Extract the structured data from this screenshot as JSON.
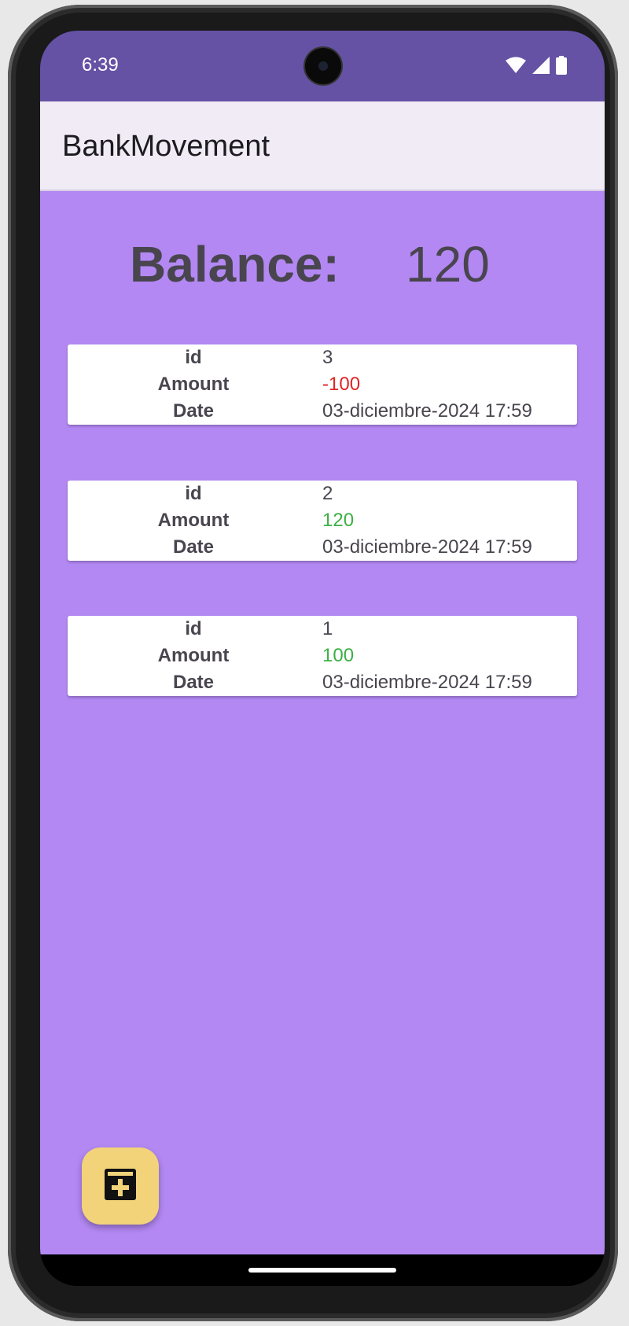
{
  "status_bar": {
    "time": "6:39",
    "icons": [
      "wifi-icon",
      "signal-icon",
      "battery-icon"
    ]
  },
  "app_bar": {
    "title": "BankMovement"
  },
  "balance": {
    "label": "Balance:",
    "value": "120"
  },
  "movements": [
    {
      "id_label": "id",
      "id": "3",
      "amount_label": "Amount",
      "amount": "-100",
      "date_label": "Date",
      "date": "03-diciembre-2024 17:59"
    },
    {
      "id_label": "id",
      "id": "2",
      "amount_label": "Amount",
      "amount": "120",
      "date_label": "Date",
      "date": "03-diciembre-2024 17:59"
    },
    {
      "id_label": "id",
      "id": "1",
      "amount_label": "Amount",
      "amount": "100",
      "date_label": "Date",
      "date": "03-diciembre-2024 17:59"
    }
  ],
  "fab": {
    "icon": "add-box-icon"
  },
  "colors": {
    "status_bar": "#6552a4",
    "app_bar": "#f1ebf6",
    "background": "#b388f3",
    "negative": "#e02424",
    "positive": "#3cb043",
    "fab": "#f2d37a"
  }
}
